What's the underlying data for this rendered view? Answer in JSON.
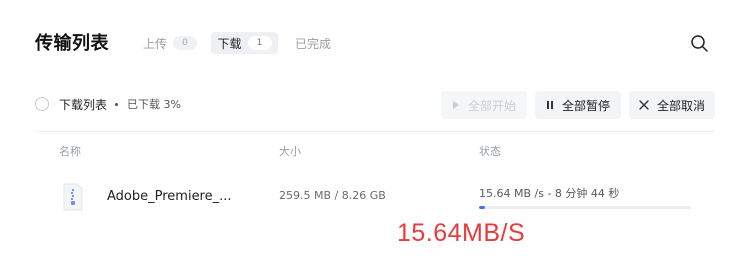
{
  "header": {
    "title": "传输列表",
    "tabs": [
      {
        "label": "上传",
        "count": "0"
      },
      {
        "label": "下载",
        "count": "1"
      },
      {
        "label": "已完成",
        "count": ""
      }
    ]
  },
  "toolbar": {
    "list_label": "下载列表",
    "progress_text": "已下载 3%",
    "start_all": "全部开始",
    "pause_all": "全部暂停",
    "cancel_all": "全部取消"
  },
  "columns": {
    "name": "名称",
    "size": "大小",
    "status": "状态"
  },
  "rows": [
    {
      "name": "Adobe_Premiere_...",
      "size": "259.5 MB / 8.26 GB",
      "status": "15.64 MB /s - 8 分钟 44 秒",
      "progress": 0.03
    }
  ],
  "overlay": {
    "speed_annotation": "15.64MB/S"
  },
  "colors": {
    "accent": "#4c6ef5",
    "annotation": "#e83b3b"
  },
  "icons": [
    "search-icon",
    "play-icon",
    "pause-icon",
    "close-icon",
    "zip-file-icon"
  ]
}
